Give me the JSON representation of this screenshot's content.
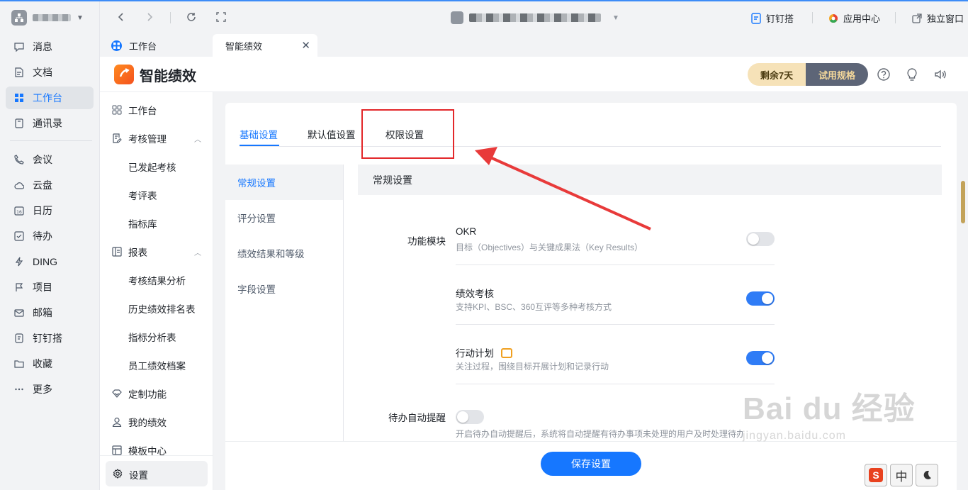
{
  "window": {
    "nav_items": [
      {
        "label": "消息",
        "icon": "chat-bubble-icon"
      },
      {
        "label": "文档",
        "icon": "document-icon"
      },
      {
        "label": "工作台",
        "icon": "grid-icon",
        "active": true
      },
      {
        "label": "通讯录",
        "icon": "contacts-icon"
      },
      {
        "label": "会议",
        "icon": "phone-icon"
      },
      {
        "label": "云盘",
        "icon": "cloud-icon"
      },
      {
        "label": "日历",
        "icon": "calendar-icon"
      },
      {
        "label": "待办",
        "icon": "checkbox-icon"
      },
      {
        "label": "DING",
        "icon": "lightning-icon"
      },
      {
        "label": "项目",
        "icon": "flag-icon"
      },
      {
        "label": "邮箱",
        "icon": "mail-icon"
      },
      {
        "label": "钉钉搭",
        "icon": "build-icon"
      },
      {
        "label": "收藏",
        "icon": "folder-icon"
      },
      {
        "label": "更多",
        "icon": "more-icon"
      }
    ],
    "toolbar": {
      "dingda_label": "钉钉搭",
      "appcenter_label": "应用中心",
      "standalone_label": "独立窗口"
    },
    "tabs": [
      {
        "label": "工作台"
      },
      {
        "label": "智能绩效"
      }
    ]
  },
  "app": {
    "title": "智能绩效",
    "logo_text": "绩效",
    "trial_remaining": "剩余7天",
    "trial_spec": "试用规格",
    "accent_color": "#1677ff",
    "menu": {
      "workbench": "工作台",
      "assessment_mgmt": "考核管理",
      "launched": "已发起考核",
      "scorecard": "考评表",
      "indicator_lib": "指标库",
      "reports": "报表",
      "result_analysis": "考核结果分析",
      "history_rank": "历史绩效排名表",
      "indicator_analysis": "指标分析表",
      "archive": "员工绩效档案",
      "custom": "定制功能",
      "my_perf": "我的绩效",
      "templates": "模板中心",
      "settings": "设置"
    }
  },
  "settings": {
    "tabs": [
      "基础设置",
      "默认值设置",
      "权限设置"
    ],
    "active_tab": "基础设置",
    "side_items": [
      "常规设置",
      "评分设置",
      "绩效结果和等级",
      "字段设置"
    ],
    "active_side": "常规设置",
    "section_title": "常规设置",
    "modules_label": "功能模块",
    "options": [
      {
        "title": "OKR",
        "desc": "目标（Objectives）与关键成果法（Key Results）",
        "enabled": false
      },
      {
        "title": "绩效考核",
        "desc": "支持KPI、BSC、360互评等多种考核方式",
        "enabled": true
      },
      {
        "title": "行动计划",
        "desc": "关注过程，围绕目标开展计划和记录行动",
        "enabled": true
      }
    ],
    "reminder_label": "待办自动提醒",
    "reminder_enabled": false,
    "reminder_desc": "开启待办自动提醒后，系统将自动提醒有待办事项未处理的用户及时处理待办",
    "save_label": "保存设置"
  },
  "watermark": {
    "big": "Bai du 经验",
    "small": "jingyan.baidu.com"
  },
  "ime": {
    "lang": "中",
    "logo": "S"
  }
}
